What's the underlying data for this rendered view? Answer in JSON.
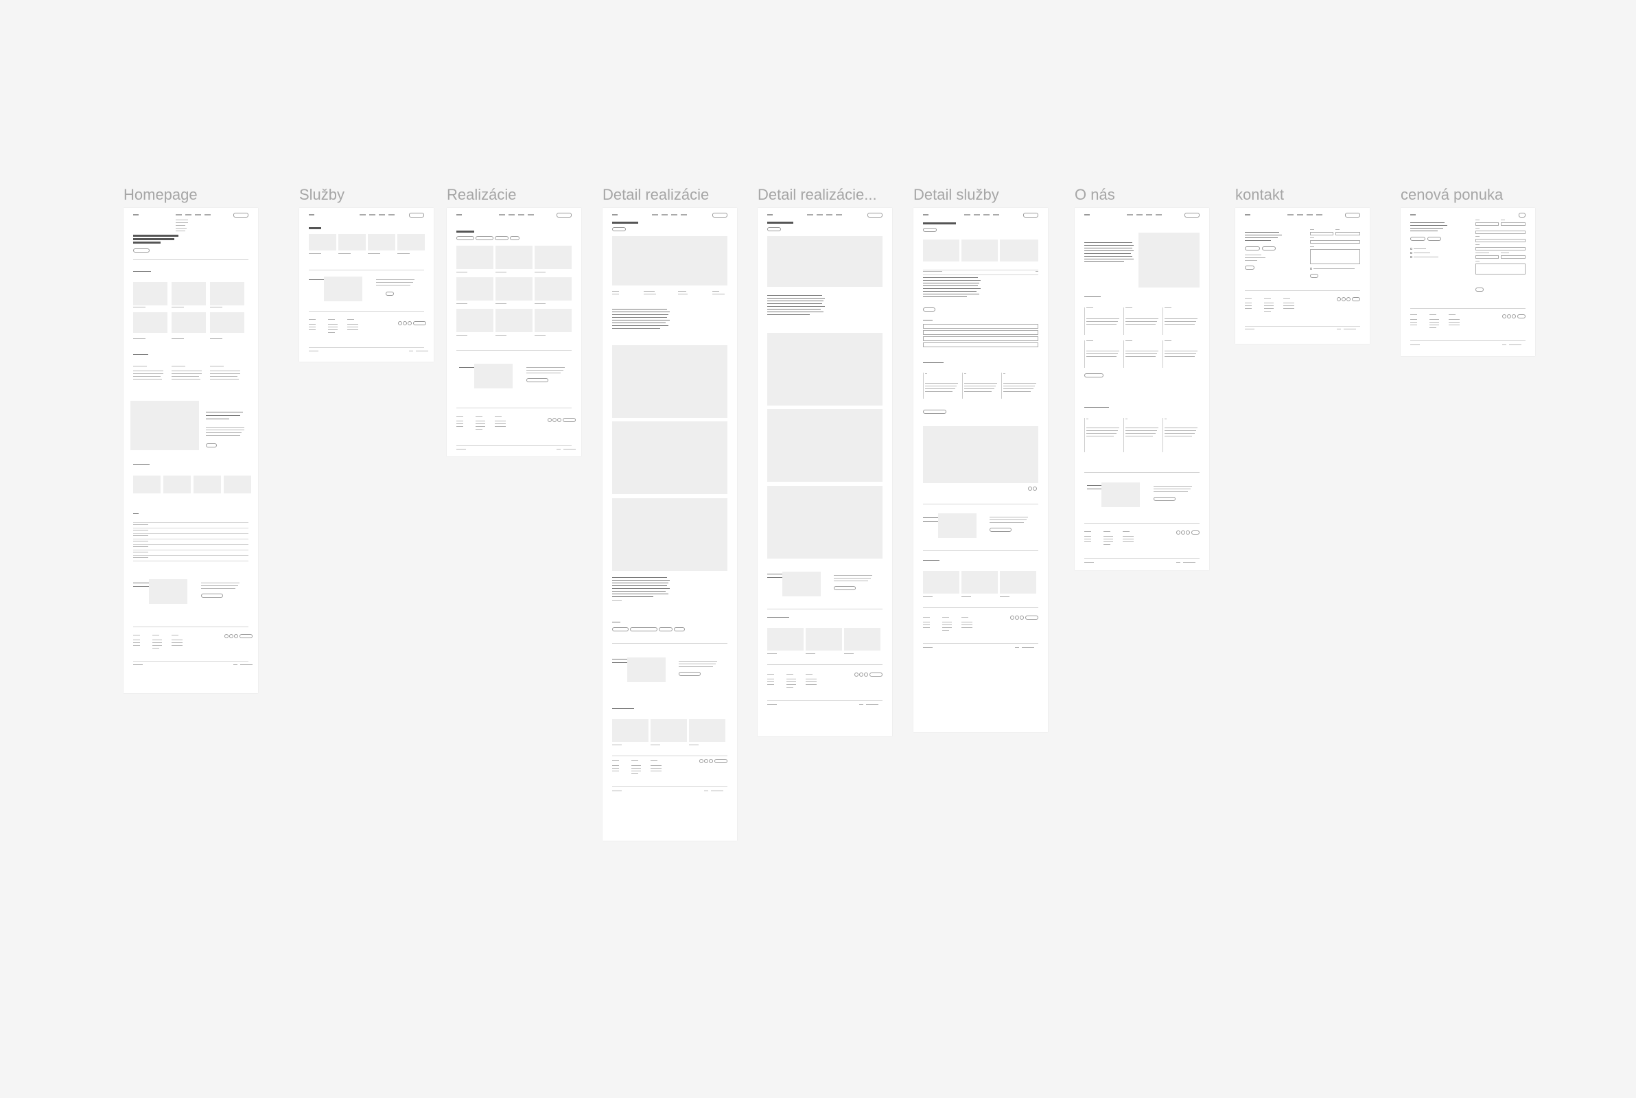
{
  "canvas": {
    "background": "#f5f5f5",
    "frame_title_color": "#a6a6a6",
    "wireframe_fill": "#eeeeee"
  },
  "frames": [
    {
      "id": "homepage",
      "title": "Homepage"
    },
    {
      "id": "sluzby",
      "title": "Služby"
    },
    {
      "id": "realizacie",
      "title": "Realizácie"
    },
    {
      "id": "detail-realizacie",
      "title": "Detail realizácie"
    },
    {
      "id": "detail-realizacie-2",
      "title": "Detail realizácie..."
    },
    {
      "id": "detail-sluzby",
      "title": "Detail služby"
    },
    {
      "id": "o-nas",
      "title": "O nás"
    },
    {
      "id": "kontakt",
      "title": "kontakt"
    },
    {
      "id": "cenova-ponuka",
      "title": "cenová ponuka"
    }
  ]
}
